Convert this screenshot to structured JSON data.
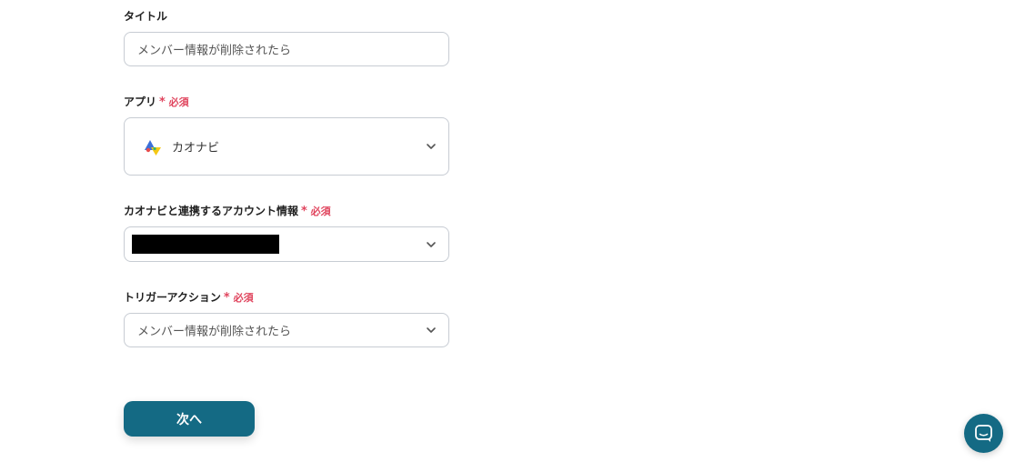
{
  "form": {
    "title": {
      "label": "タイトル",
      "value": "メンバー情報が削除されたら"
    },
    "app": {
      "label": "アプリ",
      "required": "必須",
      "required_mark": "*",
      "value": "カオナビ",
      "icon": "kaonavi-logo-icon"
    },
    "account": {
      "label": "カオナビと連携するアカウント情報",
      "required": "必須",
      "required_mark": "*",
      "value_redacted": true
    },
    "trigger": {
      "label": "トリガーアクション",
      "required": "必須",
      "required_mark": "*",
      "value": "メンバー情報が削除されたら"
    }
  },
  "next_button": {
    "label": "次へ"
  },
  "chat": {
    "icon": "chat-icon"
  },
  "colors": {
    "primary": "#146a84",
    "required": "#e0455e",
    "border": "#c7ccd3"
  }
}
